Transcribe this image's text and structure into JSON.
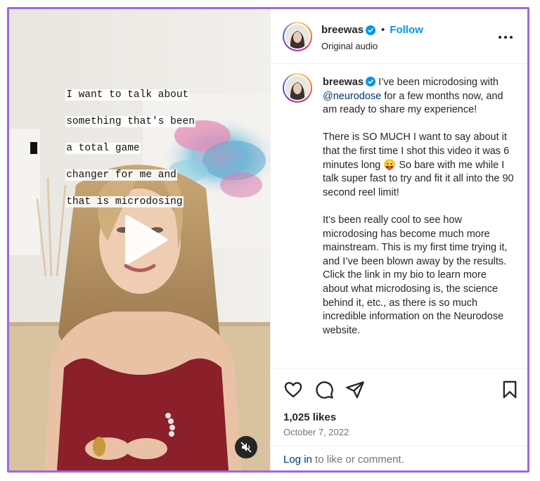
{
  "video": {
    "caption_lines": [
      "I want to talk about",
      "something that's been",
      "a total game",
      "changer for me and",
      "that is microdosing"
    ]
  },
  "header": {
    "username": "breewas",
    "separator": "•",
    "follow_label": "Follow",
    "subtitle": "Original audio"
  },
  "post": {
    "username": "breewas",
    "paragraph1_before": " I’ve been microdosing with ",
    "mention": "@neurodose",
    "paragraph1_after": " for a few months now, and am ready to share my experience!",
    "paragraph2_before": "There is SO MUCH I want to say about it that the first time I shot this video it was 6 minutes long ",
    "emoji": "😛",
    "paragraph2_after": " So bare with me while I talk super fast to try and fit it all into the 90 second reel limit!",
    "paragraph3": "It’s been really cool to see how microdosing has become much more mainstream. This is my first time trying it, and I’ve been blown away by the results. Click the link in my bio to learn more about what microdosing is, the science behind it, etc., as there is so much incredible information on the Neurodose website."
  },
  "stats": {
    "likes": "1,025 likes",
    "date": "October 7, 2022"
  },
  "login": {
    "link": "Log in",
    "rest": " to like or comment."
  },
  "colors": {
    "accent": "#0095f6",
    "frame_border": "#9b6ae0",
    "mention": "#00376b",
    "muted": "#737373"
  },
  "icons": [
    "play-icon",
    "muted-icon",
    "verified-icon",
    "more-icon",
    "heart-icon",
    "comment-icon",
    "share-icon",
    "bookmark-icon"
  ]
}
